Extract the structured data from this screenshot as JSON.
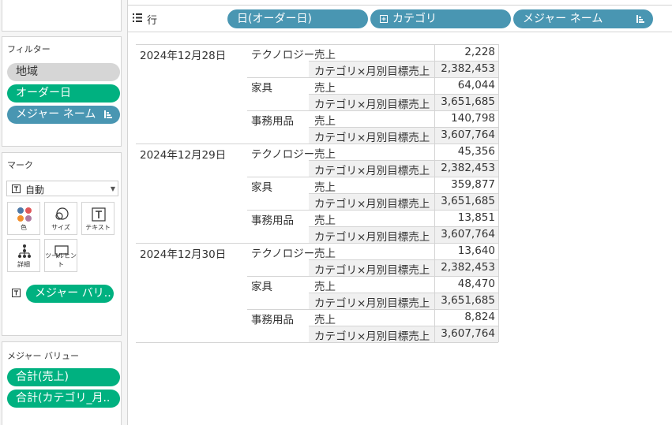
{
  "shelf": {
    "rows_label": "行",
    "pills": [
      "日(オーダー日)",
      "カテゴリ",
      "メジャー ネーム"
    ]
  },
  "filters": {
    "title": "フィルター",
    "items": [
      "地域",
      "オーダー日",
      "メジャー ネーム"
    ]
  },
  "marks": {
    "title": "マーク",
    "type_value": "自動",
    "buttons": [
      "色",
      "サイズ",
      "テキスト",
      "詳細",
      "ツールヒント"
    ],
    "field_pill": "メジャー バリ.."
  },
  "measure_values": {
    "title": "メジャー バリュー",
    "items": [
      "合計(売上)",
      "合計(カテゴリ_月.."
    ]
  },
  "table": {
    "rows": [
      {
        "date": "2024年12月28日",
        "cats": [
          {
            "cat": "テクノロジー",
            "sales": "2,228",
            "target": "2,382,453"
          },
          {
            "cat": "家具",
            "sales": "64,044",
            "target": "3,651,685"
          },
          {
            "cat": "事務用品",
            "sales": "140,798",
            "target": "3,607,764"
          }
        ]
      },
      {
        "date": "2024年12月29日",
        "cats": [
          {
            "cat": "テクノロジー",
            "sales": "45,356",
            "target": "2,382,453"
          },
          {
            "cat": "家具",
            "sales": "359,877",
            "target": "3,651,685"
          },
          {
            "cat": "事務用品",
            "sales": "13,851",
            "target": "3,607,764"
          }
        ]
      },
      {
        "date": "2024年12月30日",
        "cats": [
          {
            "cat": "テクノロジー",
            "sales": "13,640",
            "target": "2,382,453"
          },
          {
            "cat": "家具",
            "sales": "48,470",
            "target": "3,651,685"
          },
          {
            "cat": "事務用品",
            "sales": "8,824",
            "target": "3,607,764"
          }
        ]
      }
    ],
    "measure_sales": "売上",
    "measure_target": "カテゴリ×月別目標売上"
  }
}
